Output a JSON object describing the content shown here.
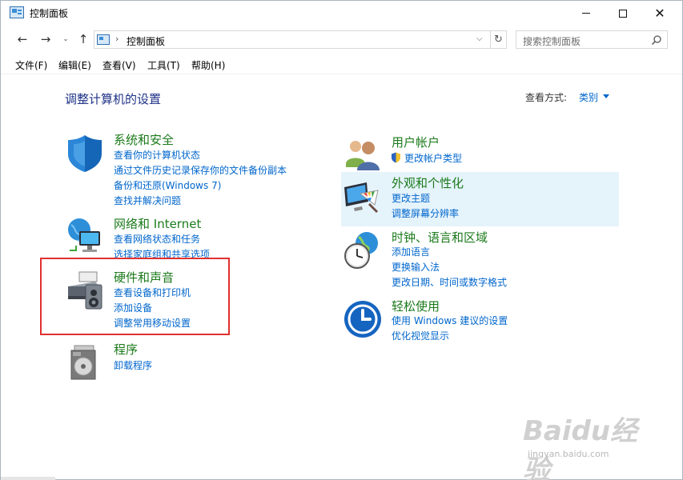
{
  "window": {
    "title": "控制面板"
  },
  "nav": {
    "breadcrumb": "控制面板",
    "search_placeholder": "搜索控制面板"
  },
  "menu": [
    {
      "label": "文件(F)"
    },
    {
      "label": "编辑(E)"
    },
    {
      "label": "查看(V)"
    },
    {
      "label": "工具(T)"
    },
    {
      "label": "帮助(H)"
    }
  ],
  "content": {
    "heading": "调整计算机的设置",
    "view_by_label": "查看方式:",
    "view_by_value": "类别"
  },
  "categories": [
    {
      "title": "系统和安全",
      "icon": "shield-icon",
      "links": [
        "查看你的计算机状态",
        "通过文件历史记录保存你的文件备份副本",
        "备份和还原(Windows 7)",
        "查找并解决问题"
      ]
    },
    {
      "title": "网络和 Internet",
      "icon": "network-globe-icon",
      "links": [
        "查看网络状态和任务",
        "选择家庭组和共享选项"
      ]
    },
    {
      "title": "硬件和声音",
      "icon": "printer-speaker-icon",
      "links": [
        "查看设备和打印机",
        "添加设备",
        "调整常用移动设置"
      ]
    },
    {
      "title": "程序",
      "icon": "programs-disc-icon",
      "links": [
        "卸载程序"
      ]
    },
    {
      "title": "用户帐户",
      "icon": "users-icon",
      "links": [
        "更改帐户类型"
      ]
    },
    {
      "title": "外观和个性化",
      "icon": "monitor-palette-icon",
      "links": [
        "更改主题",
        "调整屏幕分辨率"
      ]
    },
    {
      "title": "时钟、语言和区域",
      "icon": "clock-globe-icon",
      "links": [
        "添加语言",
        "更换输入法",
        "更改日期、时间或数字格式"
      ]
    },
    {
      "title": "轻松使用",
      "icon": "ease-of-access-icon",
      "links": [
        "使用 Windows 建议的设置",
        "优化视觉显示"
      ]
    }
  ],
  "watermark": {
    "brand": "Baidu经验",
    "url": "jingyan.baidu.com"
  },
  "colors": {
    "heading": "#1e3287",
    "category_title": "#1b7a1b",
    "link": "#0066cc",
    "highlight": "#e5f3fb",
    "annotation_box": "#e0302f"
  }
}
